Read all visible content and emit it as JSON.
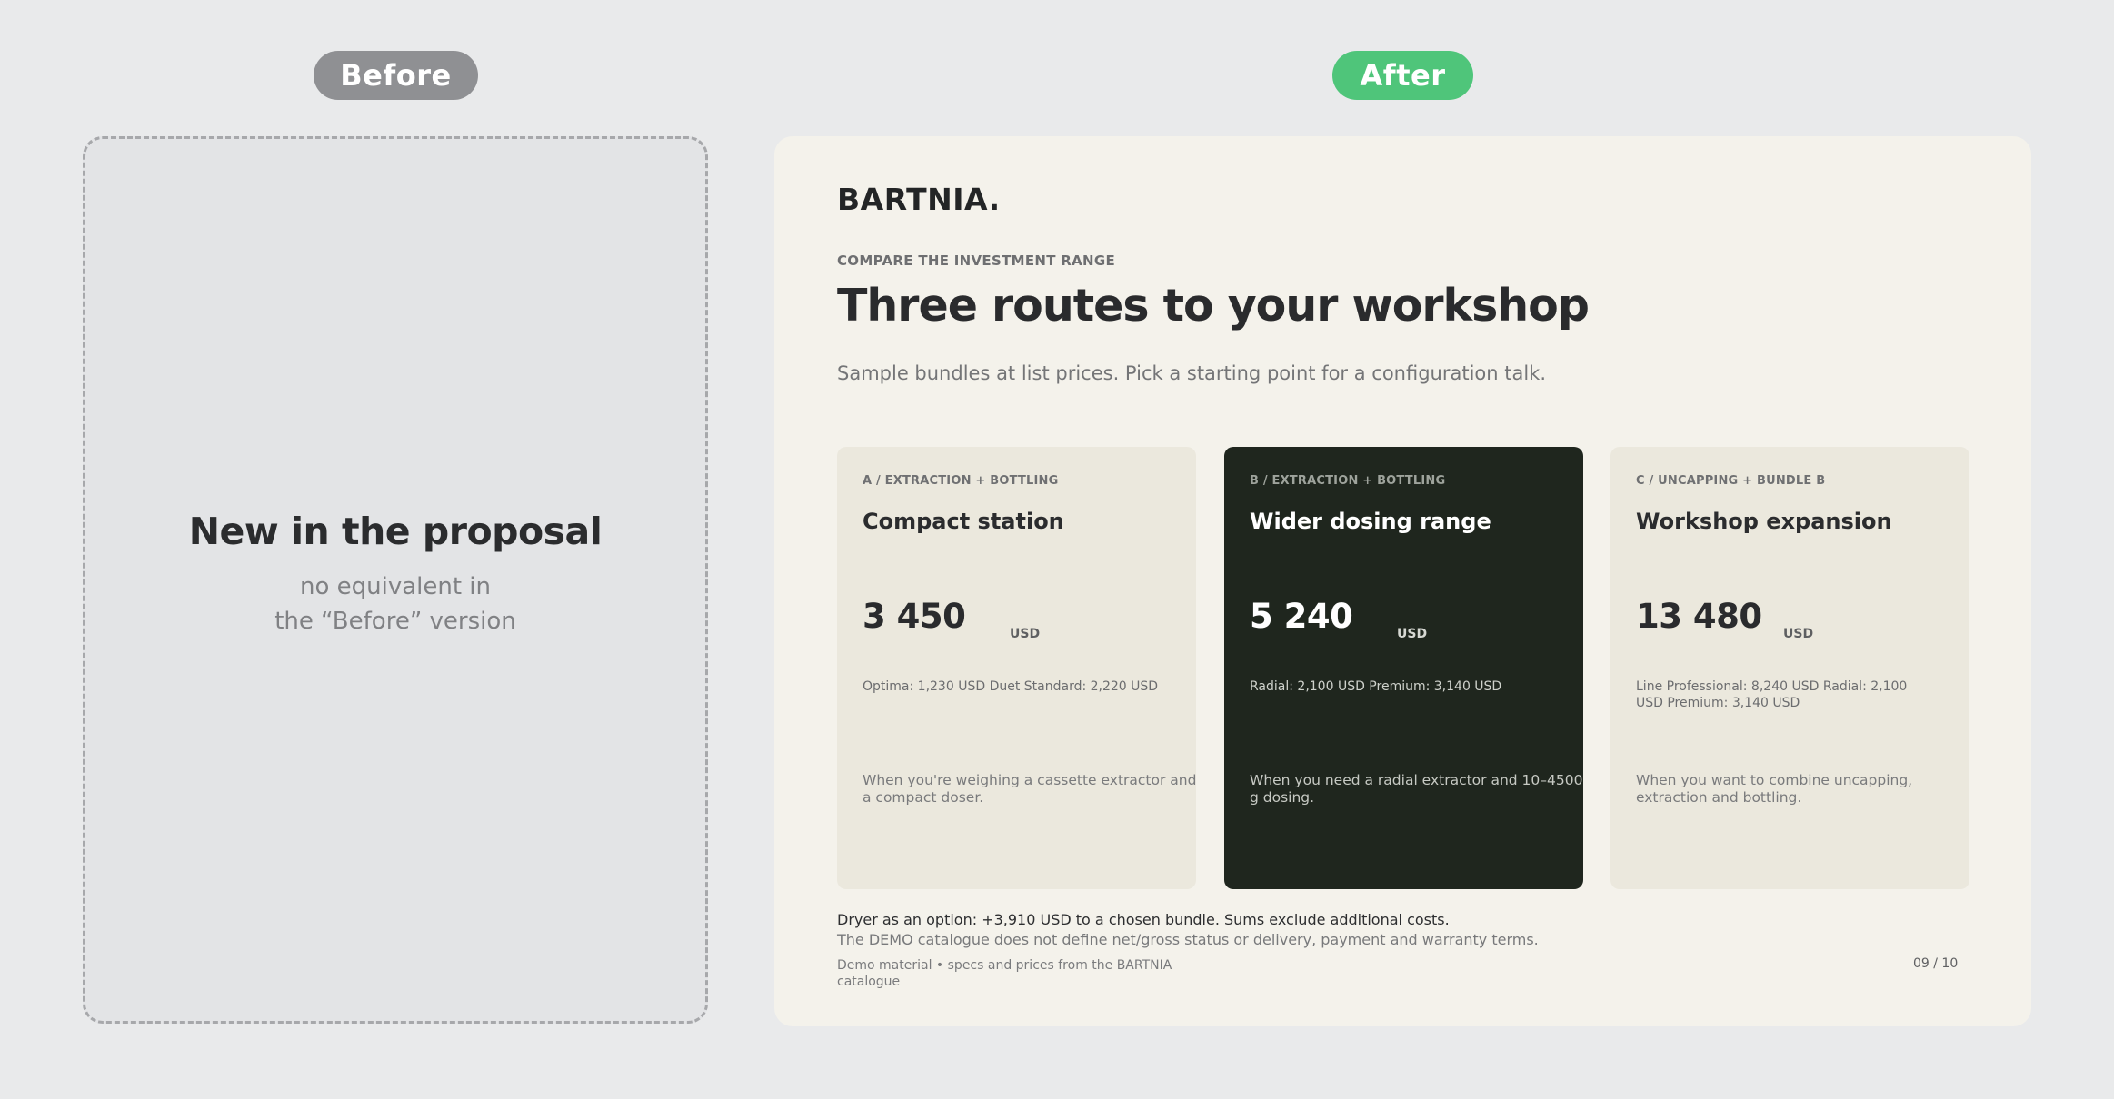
{
  "labels": {
    "before": "Before",
    "after": "After"
  },
  "before": {
    "title": "New in the proposal",
    "subtitle_line1": "no equivalent in",
    "subtitle_line2": "the “Before” version"
  },
  "after": {
    "logo": "BARTNIA.",
    "eyebrow": "COMPARE THE INVESTMENT RANGE",
    "headline": "Three routes to your workshop",
    "lede": "Sample bundles at list prices. Pick a starting point for a configuration talk.",
    "cards": [
      {
        "tag": "A / EXTRACTION + BOTTLING",
        "title": "Compact station",
        "price": "3 450",
        "currency": "USD",
        "items": "Optima: 1,230 USD Duet Standard: 2,220 USD",
        "note": "When you're weighing a cassette extractor and a compact doser."
      },
      {
        "tag": "B / EXTRACTION + BOTTLING",
        "title": "Wider dosing range",
        "price": "5 240",
        "currency": "USD",
        "items": "Radial: 2,100 USD Premium: 3,140 USD",
        "note": "When you need a radial extractor and 10–4500 g dosing."
      },
      {
        "tag": "C / UNCAPPING + BUNDLE B",
        "title": "Workshop expansion",
        "price": "13 480",
        "currency": "USD",
        "items": "Line Professional: 8,240 USD Radial: 2,100 USD Premium: 3,140 USD",
        "note": "When you want to combine uncapping, extraction and bottling."
      }
    ],
    "footnote1": "Dryer as an option: +3,910 USD to a chosen bundle. Sums exclude additional costs.",
    "footnote2": "The DEMO catalogue does not define net/gross status or delivery, payment and warranty terms.",
    "footer": "Demo material • specs and prices from the BARTNIA catalogue",
    "page": "09 / 10"
  },
  "colors": {
    "background": "#e9eaeb",
    "before_pill": "#8f9093",
    "after_pill": "#4fc57a",
    "slide_bg": "#f4f2eb",
    "card_light": "#ebe8dd",
    "card_dark": "#1f261e"
  }
}
